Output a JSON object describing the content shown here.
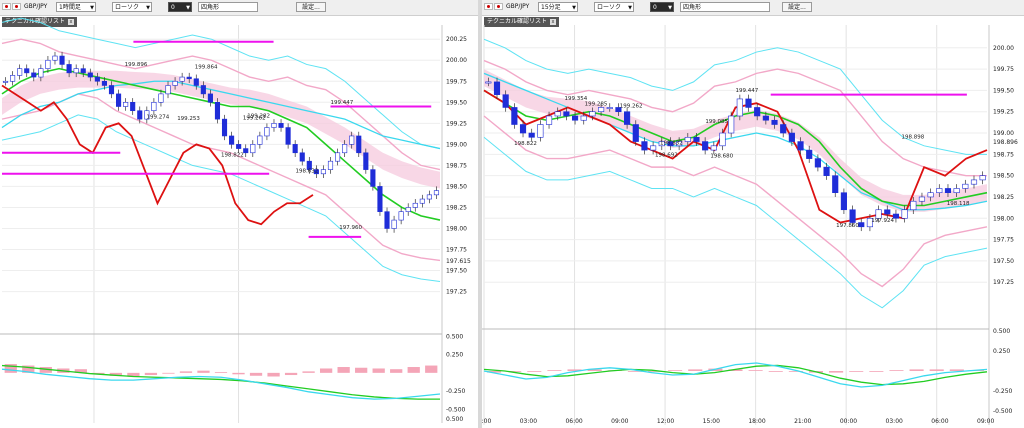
{
  "left": {
    "toolbar": {
      "pair": "GBP/JPY",
      "timeframe": "1時間足",
      "chart_type": "ローソク",
      "number": "0",
      "shape": "四角形",
      "settings": "設定..."
    },
    "panel_label": "テクニカル確認リスト",
    "chart_data": {
      "type": "candlestick",
      "title": "",
      "price_axis_ticks": [
        200.25,
        200.0,
        199.75,
        199.5,
        199.25,
        199.0,
        198.75,
        198.5,
        198.25,
        198.0,
        197.75,
        197.5,
        197.25
      ],
      "price_axis_extra": [
        "197.615"
      ],
      "ylim": [
        197.15,
        200.3
      ],
      "osc_axis_ticks": [
        "0.500",
        "0.250",
        "-0.250",
        "-0.500"
      ],
      "osc_axis_bottom": "0.500",
      "osc_ylim": [
        -0.55,
        0.45
      ],
      "annotations": [
        "200.905",
        "199.896",
        "199.864",
        "199.447",
        "199.282",
        "199.262",
        "199.274",
        "199.253",
        "198.822",
        "198.632",
        "197.960"
      ],
      "horizontal_levels": [
        200.22,
        199.45,
        198.9,
        198.65,
        197.9
      ],
      "candles_close": [
        199.75,
        199.82,
        199.9,
        199.85,
        199.8,
        199.9,
        200.0,
        200.05,
        199.95,
        199.85,
        199.9,
        199.85,
        199.8,
        199.75,
        199.7,
        199.6,
        199.45,
        199.5,
        199.4,
        199.3,
        199.4,
        199.5,
        199.6,
        199.7,
        199.75,
        199.8,
        199.78,
        199.7,
        199.6,
        199.5,
        199.3,
        199.1,
        199.0,
        198.95,
        198.9,
        199.0,
        199.1,
        199.2,
        199.25,
        199.2,
        199.0,
        198.9,
        198.8,
        198.7,
        198.65,
        198.7,
        198.8,
        198.9,
        199.0,
        199.1,
        198.9,
        198.7,
        198.5,
        198.2,
        198.0,
        198.1,
        198.2,
        198.25,
        198.3,
        198.35,
        198.4,
        198.45
      ],
      "bollinger_upper": [
        200.2,
        200.25,
        200.2,
        200.1,
        200.05,
        200.0,
        199.95,
        199.9,
        199.95,
        200.0,
        200.05,
        200.0,
        199.9,
        199.8,
        199.75,
        199.8,
        199.7,
        199.65,
        199.5,
        199.3,
        199.1,
        198.9,
        198.75,
        198.7
      ],
      "bollinger_lower": [
        199.3,
        199.35,
        199.4,
        199.5,
        199.6,
        199.55,
        199.4,
        199.3,
        199.2,
        199.1,
        199.0,
        198.95,
        198.9,
        198.8,
        198.7,
        198.6,
        198.5,
        198.4,
        198.2,
        198.0,
        197.8,
        197.7,
        197.65,
        197.62
      ],
      "ma_fast": [
        199.6,
        199.75,
        199.85,
        199.9,
        199.85,
        199.8,
        199.75,
        199.7,
        199.65,
        199.6,
        199.55,
        199.5,
        199.45,
        199.45,
        199.4,
        199.3,
        199.2,
        199.0,
        198.8,
        198.6,
        198.4,
        198.25,
        198.15,
        198.1
      ],
      "ma_slow": [
        199.2,
        199.35,
        199.45,
        199.5,
        199.6,
        199.65,
        199.7,
        199.72,
        199.75,
        199.75,
        199.7,
        199.65,
        199.6,
        199.55,
        199.5,
        199.45,
        199.4,
        199.35,
        199.3,
        199.2,
        199.1,
        199.05,
        199.0,
        198.95
      ],
      "rsi_line": [
        199.7,
        199.6,
        199.5,
        199.4,
        199.5,
        199.3,
        199.0,
        198.9,
        199.2,
        199.25,
        199.1,
        198.7,
        198.3,
        198.6,
        198.9,
        199.0,
        198.95,
        198.75,
        198.3,
        198.1,
        198.05,
        198.2,
        198.3,
        198.3,
        198.4
      ],
      "macd_hist": [
        0.12,
        0.1,
        0.08,
        0.06,
        0.05,
        -0.02,
        -0.04,
        -0.05,
        -0.03,
        -0.01,
        0.02,
        0.03,
        0.01,
        -0.02,
        -0.04,
        -0.05,
        -0.03,
        0.02,
        0.06,
        0.08,
        0.07,
        0.06,
        0.05,
        0.08,
        0.1
      ],
      "macd_line": [
        0.05,
        0.02,
        -0.02,
        -0.05,
        -0.08,
        -0.1,
        -0.1,
        -0.08,
        -0.06,
        -0.05,
        -0.06,
        -0.1,
        -0.15,
        -0.2,
        -0.26,
        -0.3,
        -0.34,
        -0.36,
        -0.35,
        -0.32,
        -0.29
      ],
      "signal_line": [
        0.1,
        0.08,
        0.05,
        0.02,
        -0.01,
        -0.03,
        -0.05,
        -0.06,
        -0.07,
        -0.08,
        -0.09,
        -0.11,
        -0.14,
        -0.18,
        -0.22,
        -0.26,
        -0.3,
        -0.33,
        -0.35,
        -0.36,
        -0.36
      ]
    }
  },
  "right": {
    "toolbar": {
      "pair": "GBP/JPY",
      "timeframe": "15分足",
      "chart_type": "ローソク",
      "number": "0",
      "shape": "四角形",
      "settings": "設定..."
    },
    "panel_label": "テクニカル確認リスト",
    "chart_data": {
      "type": "candlestick",
      "title": "",
      "price_axis_ticks": [
        200.0,
        199.75,
        199.5,
        199.25,
        199.0,
        198.75,
        198.5,
        198.25,
        198.0,
        197.75,
        197.5,
        197.25
      ],
      "price_axis_extra": [
        "198.896"
      ],
      "ylim": [
        197.1,
        200.15
      ],
      "osc_axis_ticks": [
        "0.500",
        "0.250",
        "-0.250",
        "-0.500"
      ],
      "osc_ylim": [
        -0.55,
        0.45
      ],
      "x_ticks": [
        "00:00",
        "03:00",
        "06:00",
        "09:00",
        "12:00",
        "15:00",
        "18:00",
        "21:00",
        "00:00",
        "03:00",
        "06:00",
        "09:00"
      ],
      "annotations": [
        "199.447",
        "199.354",
        "199.285",
        "199.262",
        "199.085",
        "198.822",
        "198.832",
        "198.692",
        "198.680",
        "198.898",
        "197.924",
        "197.860",
        "198.118"
      ],
      "horizontal_levels": [
        199.45
      ],
      "candles_close": [
        199.6,
        199.45,
        199.3,
        199.1,
        199.0,
        198.95,
        199.1,
        199.2,
        199.25,
        199.2,
        199.15,
        199.2,
        199.25,
        199.3,
        199.3,
        199.25,
        199.1,
        198.9,
        198.8,
        198.85,
        198.9,
        198.85,
        198.9,
        198.95,
        198.9,
        198.8,
        198.85,
        199.0,
        199.2,
        199.4,
        199.3,
        199.2,
        199.15,
        199.1,
        199.0,
        198.9,
        198.8,
        198.7,
        198.6,
        198.5,
        198.3,
        198.1,
        197.95,
        197.9,
        198.0,
        198.1,
        198.05,
        198.0,
        198.1,
        198.2,
        198.25,
        198.3,
        198.35,
        198.3,
        198.35,
        198.4,
        198.45,
        198.5
      ],
      "bollinger_upper": [
        199.85,
        199.75,
        199.6,
        199.5,
        199.45,
        199.5,
        199.45,
        199.4,
        199.3,
        199.25,
        199.35,
        199.55,
        199.6,
        199.7,
        199.75,
        199.7,
        199.6,
        199.5,
        199.2,
        198.9,
        198.7,
        198.6,
        198.55,
        198.5,
        198.5
      ],
      "bollinger_lower": [
        199.2,
        199.0,
        198.8,
        198.7,
        198.7,
        198.75,
        198.8,
        198.7,
        198.6,
        198.6,
        198.5,
        198.6,
        198.5,
        198.4,
        198.2,
        198.0,
        197.8,
        197.6,
        197.35,
        197.2,
        197.4,
        197.7,
        197.8,
        197.85,
        197.9
      ],
      "ma_fast": [
        199.5,
        199.35,
        199.2,
        199.15,
        199.2,
        199.25,
        199.2,
        199.1,
        199.0,
        198.9,
        198.95,
        199.1,
        199.2,
        199.25,
        199.2,
        199.1,
        198.9,
        198.6,
        198.35,
        198.2,
        198.15,
        198.15,
        198.2,
        198.25,
        198.3
      ],
      "ma_slow": [
        199.7,
        199.6,
        199.5,
        199.4,
        199.3,
        199.2,
        199.1,
        199.0,
        198.9,
        198.85,
        198.85,
        198.9,
        198.95,
        199.0,
        198.95,
        198.85,
        198.7,
        198.5,
        198.3,
        198.2,
        198.1,
        198.1,
        198.12,
        198.15,
        198.2
      ],
      "rsi_line": [
        199.5,
        199.35,
        199.1,
        199.2,
        199.3,
        199.2,
        199.1,
        198.9,
        198.8,
        198.7,
        198.9,
        198.8,
        199.3,
        199.35,
        199.25,
        198.8,
        198.1,
        197.95,
        198.0,
        198.05,
        198.0,
        198.6,
        198.5,
        198.7,
        198.8
      ],
      "macd_hist": [
        -0.02,
        -0.01,
        0.0,
        0.01,
        0.02,
        0.02,
        0.01,
        0.0,
        -0.01,
        0.01,
        0.02,
        0.03,
        0.02,
        0.01,
        0.0,
        -0.01,
        -0.02,
        -0.02,
        -0.01,
        0.0,
        0.01,
        0.02,
        0.02,
        0.02,
        0.01
      ],
      "macd_line": [
        0.0,
        -0.05,
        -0.1,
        -0.08,
        -0.02,
        0.02,
        0.04,
        0.02,
        -0.02,
        -0.05,
        -0.04,
        0.02,
        0.08,
        0.1,
        0.06,
        0.0,
        -0.08,
        -0.16,
        -0.2,
        -0.18,
        -0.12,
        -0.06,
        -0.02,
        0.0,
        0.02
      ],
      "signal_line": [
        0.02,
        0.0,
        -0.04,
        -0.07,
        -0.06,
        -0.03,
        0.0,
        0.02,
        0.01,
        -0.02,
        -0.04,
        -0.02,
        0.02,
        0.06,
        0.07,
        0.04,
        -0.02,
        -0.09,
        -0.14,
        -0.17,
        -0.16,
        -0.13,
        -0.08,
        -0.04,
        -0.01
      ]
    }
  },
  "colors": {
    "bull_candle": "#ffffff",
    "bear_candle": "#1f2dd8",
    "bollinger": "#f2a8c8",
    "bollinger_outer": "#5ee3f3",
    "ma_fast": "#22cc22",
    "ma_slow": "#3ad8ee",
    "rsi": "#dd1111",
    "cloud": "#f6c9de",
    "cloud_blue": "#bfe3f7",
    "level": "#ee11ee",
    "macd_hist": "#f4a5b7",
    "axis_text": "#222222",
    "grid": "#c8c8c8"
  }
}
